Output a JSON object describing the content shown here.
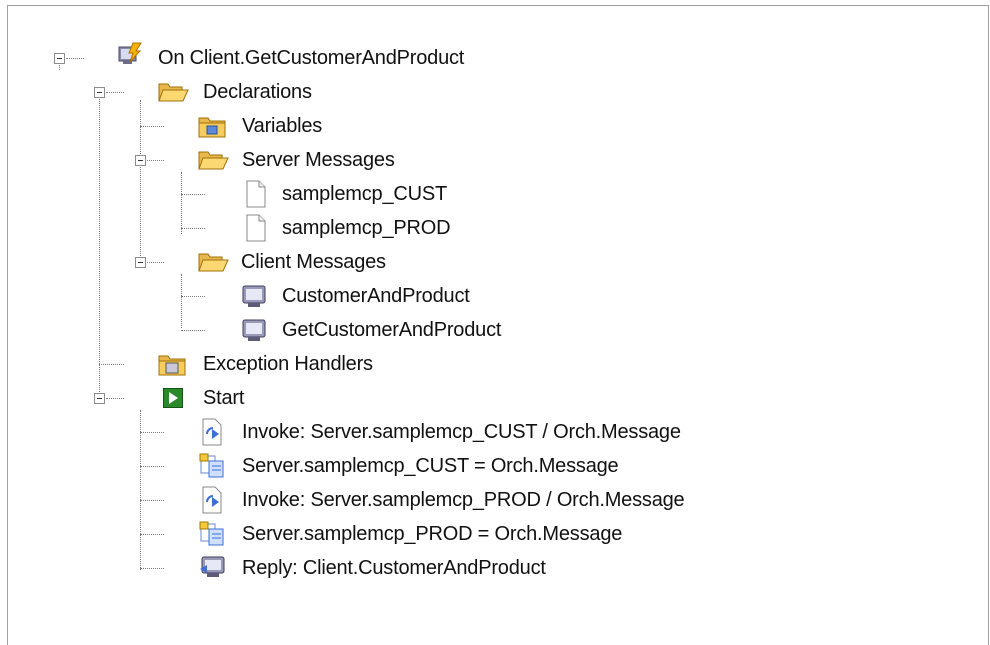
{
  "tree": {
    "root": {
      "label": "On Client.GetCustomerAndProduct",
      "icon": "orchestration-icon"
    },
    "declarations": {
      "label": "Declarations",
      "icon": "folder-open-icon"
    },
    "variables": {
      "label": "Variables",
      "icon": "variables-folder-icon"
    },
    "server_messages": {
      "label": "Server Messages",
      "icon": "folder-open-icon"
    },
    "server_msg_1": {
      "label": "samplemcp_CUST",
      "icon": "document-icon"
    },
    "server_msg_2": {
      "label": "samplemcp_PROD",
      "icon": "document-icon"
    },
    "client_messages": {
      "label": "Client Messages",
      "icon": "folder-open-icon"
    },
    "client_msg_1": {
      "label": "CustomerAndProduct",
      "icon": "monitor-message-icon"
    },
    "client_msg_2": {
      "label": "GetCustomerAndProduct",
      "icon": "monitor-message-icon"
    },
    "exception_handlers": {
      "label": "Exception Handlers",
      "icon": "exception-folder-icon"
    },
    "start": {
      "label": "Start",
      "icon": "start-icon"
    },
    "steps": [
      {
        "label": "Invoke: Server.samplemcp_CUST / Orch.Message",
        "icon": "invoke-icon"
      },
      {
        "label": "Server.samplemcp_CUST = Orch.Message",
        "icon": "assign-icon"
      },
      {
        "label": "Invoke: Server.samplemcp_PROD / Orch.Message",
        "icon": "invoke-icon"
      },
      {
        "label": "Server.samplemcp_PROD = Orch.Message",
        "icon": "assign-icon"
      },
      {
        "label": "Reply: Client.CustomerAndProduct",
        "icon": "reply-icon"
      }
    ]
  }
}
